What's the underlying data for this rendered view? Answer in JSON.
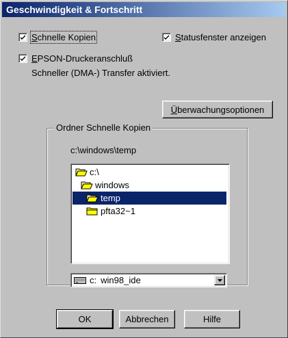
{
  "window": {
    "title": "Geschwindigkeit & Fortschritt"
  },
  "options": {
    "fast_copies": {
      "label_mnemonic": "S",
      "label_rest": "chnelle Kopien",
      "checked": true
    },
    "status_window": {
      "label_mnemonic": "S",
      "label_rest": "tatusfenster anzeigen",
      "checked": true
    },
    "epson_port": {
      "label_mnemonic": "E",
      "label_rest": "PSON-Druckeranschluß",
      "checked": true
    },
    "dma_note": "Schneller (DMA-) Transfer aktiviert."
  },
  "monitor_button": {
    "mnemonic": "Ü",
    "rest": "berwachungsoptionen"
  },
  "folder_group": {
    "label": "Ordner Schnelle Kopien",
    "path": "c:\\windows\\temp",
    "tree": [
      {
        "label": "c:\\",
        "icon": "open-folder-icon",
        "selected": false
      },
      {
        "label": "windows",
        "icon": "open-folder-icon",
        "selected": false
      },
      {
        "label": "temp",
        "icon": "open-folder-icon",
        "selected": true
      },
      {
        "label": "pfta32~1",
        "icon": "closed-folder-icon",
        "selected": false
      }
    ],
    "drive": {
      "letter": "c:",
      "name": "win98_ide",
      "icon": "hard-drive-icon"
    }
  },
  "buttons": {
    "ok": "OK",
    "cancel": "Abbrechen",
    "help": "Hilfe"
  }
}
